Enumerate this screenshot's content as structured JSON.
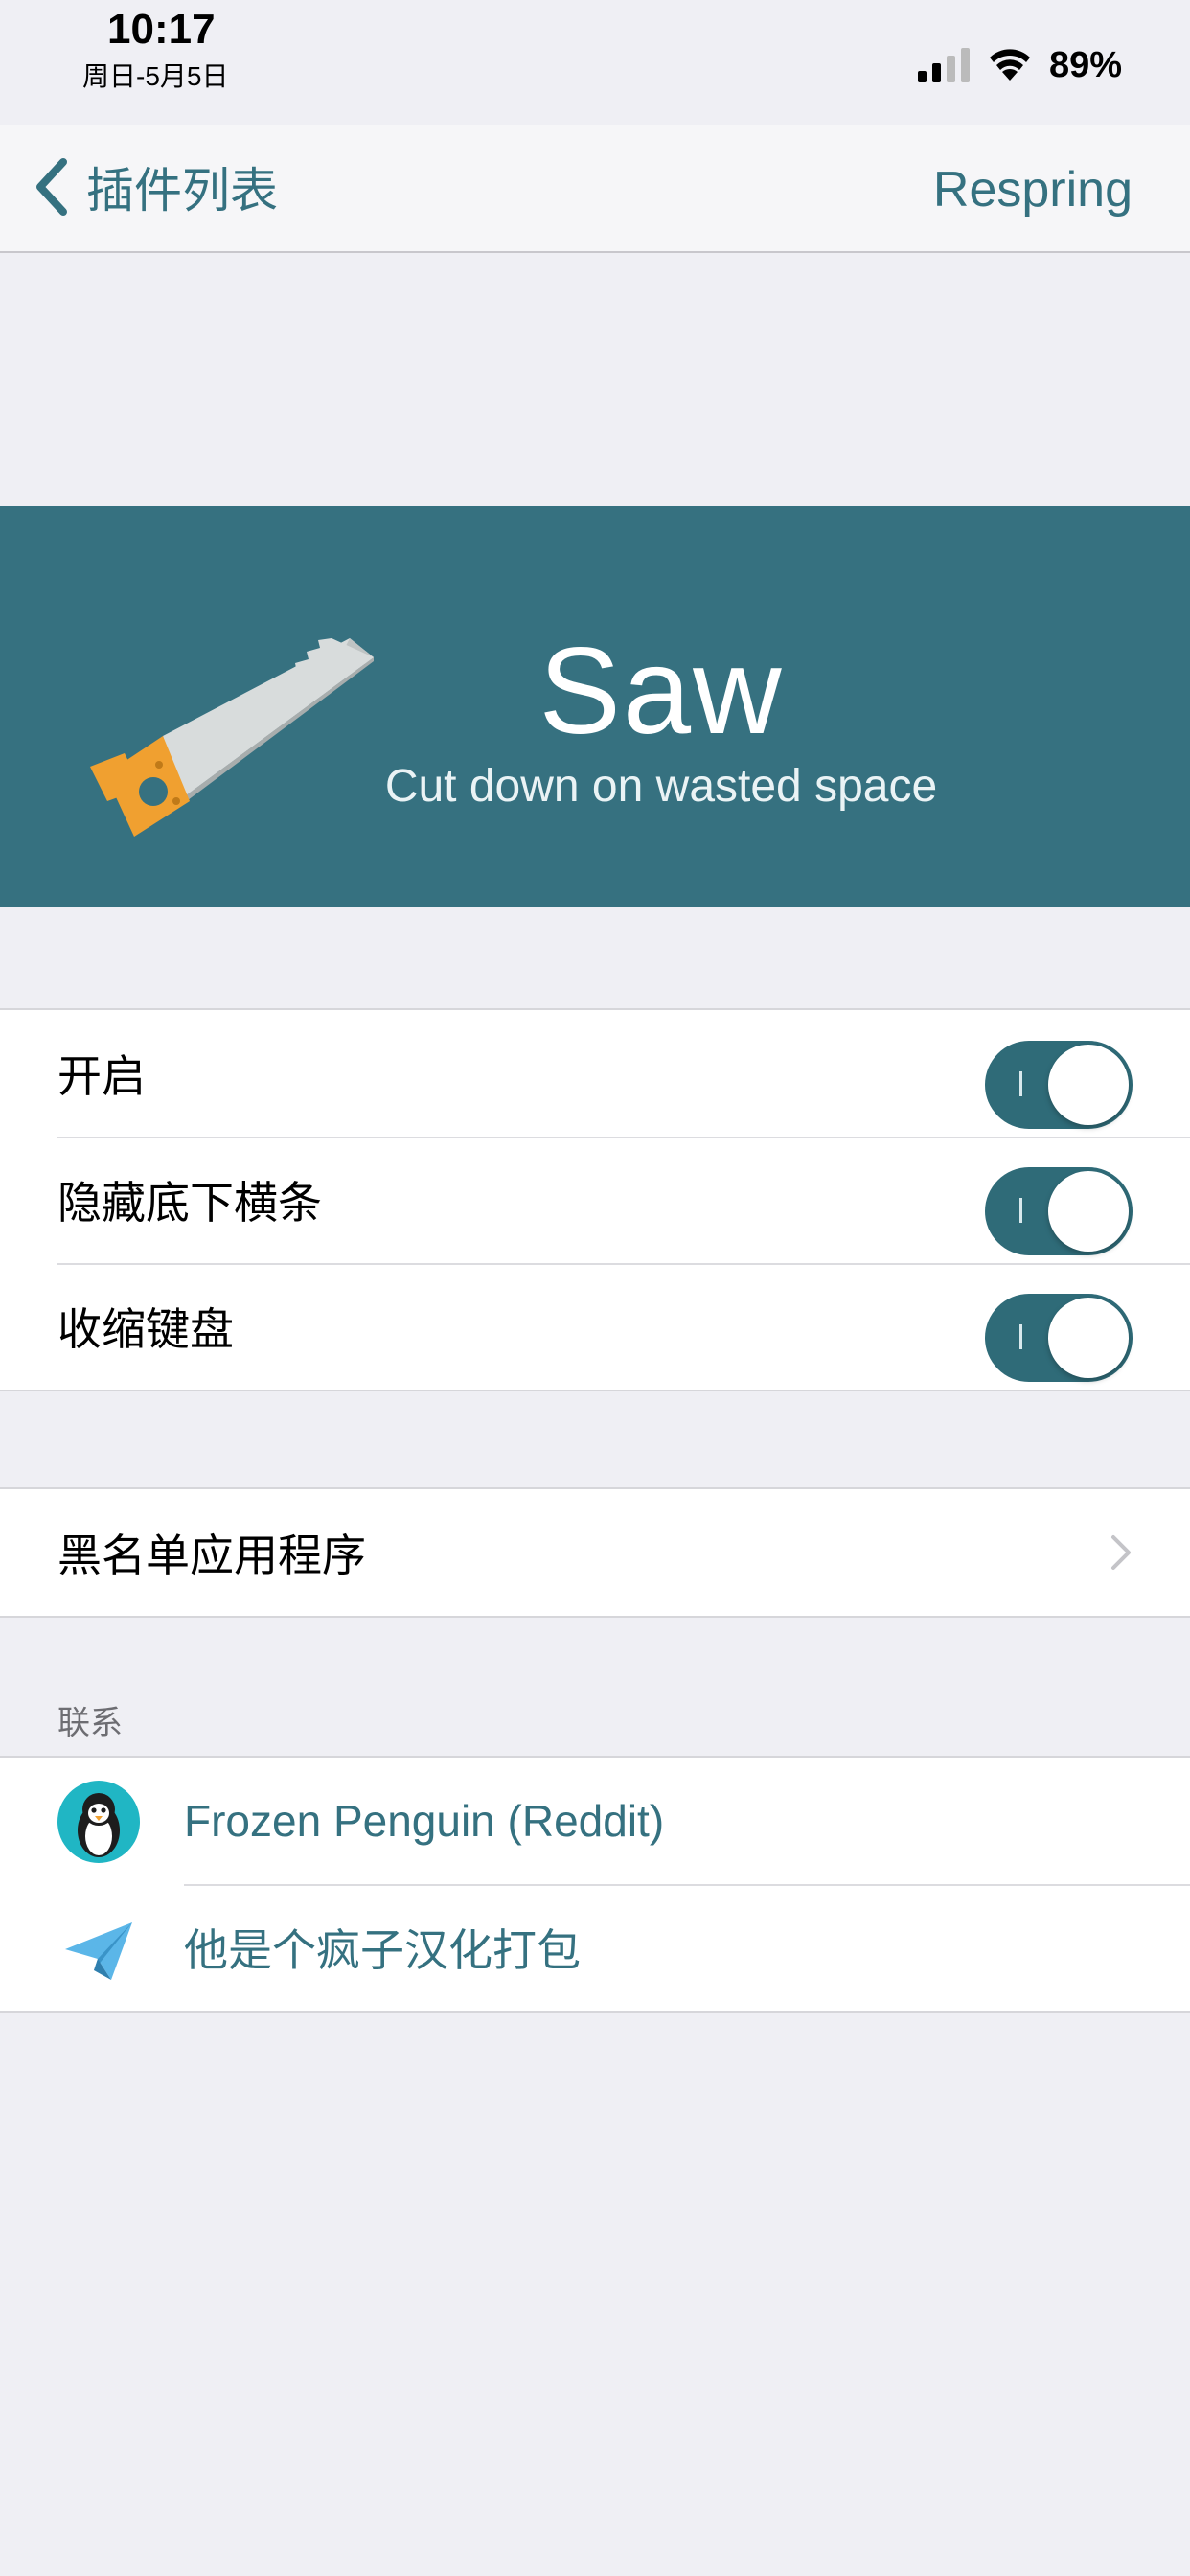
{
  "status_bar": {
    "time": "10:17",
    "date": "周日-5月5日",
    "battery": "89%"
  },
  "nav": {
    "back_label": "插件列表",
    "right_button": "Respring"
  },
  "banner": {
    "title": "Saw",
    "subtitle": "Cut down on wasted space",
    "background_color": "#367180"
  },
  "settings_group": {
    "rows": [
      {
        "label": "开启",
        "toggle_on": true
      },
      {
        "label": "隐藏底下横条",
        "toggle_on": true
      },
      {
        "label": "收缩键盘",
        "toggle_on": true
      }
    ]
  },
  "blacklist_group": {
    "label": "黑名单应用程序",
    "accessory": "chevron-right-icon"
  },
  "contact_section": {
    "header": "联系",
    "rows": [
      {
        "label": "Frozen Penguin (Reddit)",
        "icon": "penguin-icon"
      },
      {
        "label": "他是个疯子汉化打包",
        "icon": "paper-plane-icon"
      }
    ]
  },
  "accent_color": "#357180"
}
